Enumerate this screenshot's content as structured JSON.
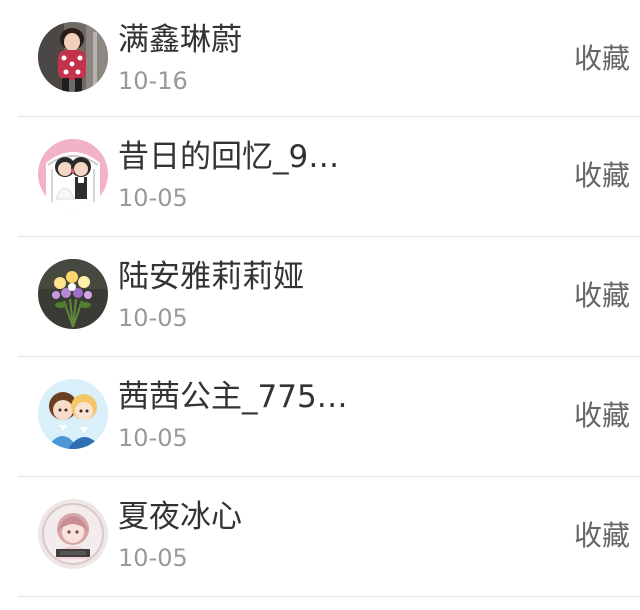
{
  "items": [
    {
      "name": "满鑫琳蔚",
      "date": "10-16",
      "action_label": "收藏",
      "avatar_icon": "girl-photo-avatar"
    },
    {
      "name": "昔日的回忆_9…",
      "date": "10-05",
      "action_label": "收藏",
      "avatar_icon": "cartoon-couple-avatar"
    },
    {
      "name": "陆安雅莉莉娅",
      "date": "10-05",
      "action_label": "收藏",
      "avatar_icon": "flower-bouquet-avatar"
    },
    {
      "name": "茜茜公主_775…",
      "date": "10-05",
      "action_label": "收藏",
      "avatar_icon": "anime-boys-avatar"
    },
    {
      "name": "夏夜冰心",
      "date": "10-05",
      "action_label": "收藏",
      "avatar_icon": "anime-girl-avatar"
    }
  ]
}
